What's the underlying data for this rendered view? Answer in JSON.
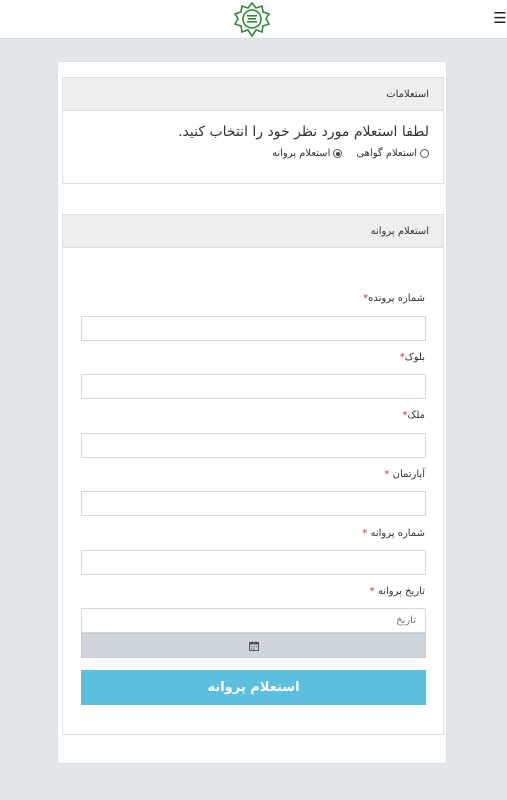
{
  "header": {
    "logo_icon": "municipality-emblem-icon",
    "menu_icon": "hamburger-menu-icon",
    "menu_glyph": "☰"
  },
  "inquiries_card": {
    "title": "استعلامات",
    "prompt": "لطفا استعلام مورد نظر خود را انتخاب کنید.",
    "options": [
      {
        "label": "استعلام گواهی",
        "selected": false
      },
      {
        "label": "استعلام پروانه",
        "selected": true
      }
    ]
  },
  "permit_card": {
    "title": "استعلام پروانه",
    "fields": [
      {
        "label": "شماره پرونده",
        "required_mark": "*",
        "value": ""
      },
      {
        "label": "بلوک",
        "required_mark": "*",
        "value": ""
      },
      {
        "label": "ملک",
        "required_mark": "*",
        "value": ""
      },
      {
        "label": "آپارتمان",
        "required_mark": "*",
        "value": ""
      },
      {
        "label": "شماره پروانه",
        "required_mark": "*",
        "value": ""
      },
      {
        "label": "تاریخ پروانه",
        "required_mark": "*",
        "placeholder": "تاریخ"
      }
    ],
    "calendar_icon": "calendar-icon",
    "submit_label": "استعلام پروانه"
  },
  "colors": {
    "accent": "#5bc0de",
    "required": "#e0262a",
    "logo_green": "#2e8b3a"
  }
}
